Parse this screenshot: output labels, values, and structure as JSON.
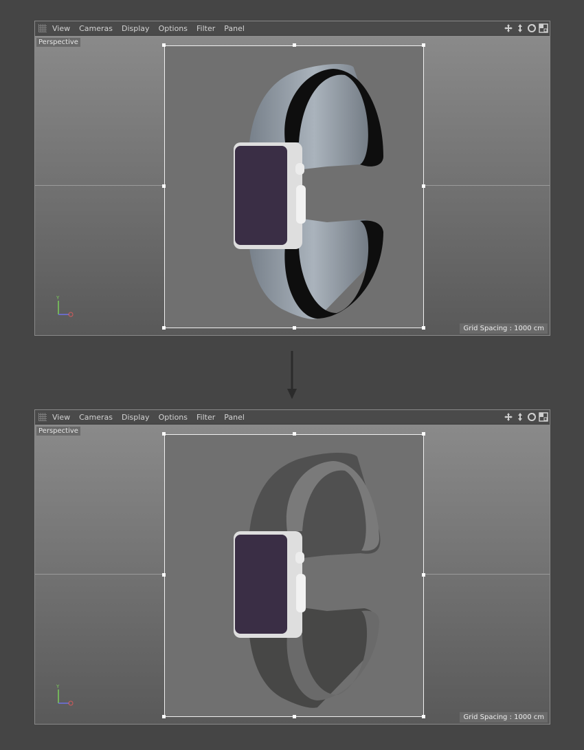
{
  "menu": [
    "View",
    "Cameras",
    "Display",
    "Options",
    "Filter",
    "Panel"
  ],
  "nav_icons": [
    "move-view-icon",
    "zoom-view-icon",
    "rotate-view-icon",
    "toggle-layout-icon"
  ],
  "viewports": [
    {
      "label": "Perspective",
      "grid_spacing": "Grid Spacing : 1000 cm",
      "band_material": "glossy-blue-gray",
      "band_color": "#9aa4ad"
    },
    {
      "label": "Perspective",
      "grid_spacing": "Grid Spacing : 1000 cm",
      "band_material": "dark-gray",
      "band_color": "#4d4d4c"
    }
  ],
  "colors": {
    "ui_background": "#454545",
    "menu_text": "#d3d3d3",
    "screen": "#3a2e45",
    "watch_case": "#dedede",
    "axis_y": "#7cd05a",
    "axis_z": "#6e72e6",
    "axis_x": "#d55a5a"
  }
}
